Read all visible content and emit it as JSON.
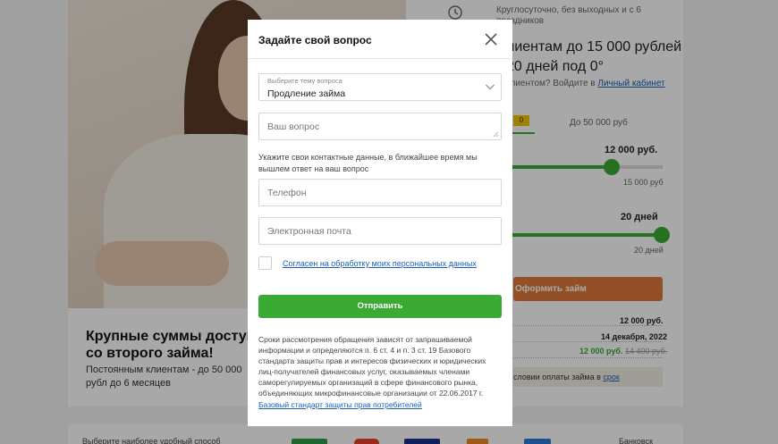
{
  "background": {
    "clock_text": "Круглосуточно, без выходных и с 6 праздников",
    "headline_line1": "лиентам до 15 000 рублей",
    "headline_line2": "20 дней под 0°",
    "client_prompt": "клиентом? Войдите в",
    "cabinet_link": "Личный кабинет",
    "tab_badge": "0",
    "tab_other": "До 50 000 руб",
    "amount_value": "12 000 руб.",
    "amount_max": "15 000 руб",
    "days_value": "20 дней",
    "days_max": "20 дней",
    "apply_button": "Оформить займ",
    "summary_amount": "12 000 руб.",
    "summary_date": "14 декабря, 2022",
    "summary_new": "12 000 руб.",
    "summary_old": "14 400 руб.",
    "grace_text": "словии оплаты займа в",
    "grace_link": "срок",
    "promo_title": "Крупные суммы доступн со второго займа!",
    "promo_text": "Постоянным клиентам - до 50 000 рубл до 6 месяцев",
    "payment_label": "Выберите наиболее удобный способ",
    "payment_right": "Банковск"
  },
  "modal": {
    "title": "Задайте свой вопрос",
    "topic_label": "Выберите тему вопроса",
    "topic_value": "Продление займа",
    "question_placeholder": "Ваш вопрос",
    "contact_hint": "Укажите свои контактные данные, в ближайшее время мы вышлем ответ на ваш вопрос",
    "phone_placeholder": "Телефон",
    "email_placeholder": "Электронная почта",
    "consent_label": "Согласен на обработку моих персональных данных",
    "submit_label": "Отправить",
    "terms_text": "Сроки рассмотрения обращения зависят от запрашиваемой информации и определяются п. 6 ст. 4 и п. 3 ст. 19 Базового стандарта защиты прав и интересов физических и юридических лиц-получателей финансовых услуг, оказываемых членами саморегулируемых организаций в сфере финансового рынка, объединяющих микрофинансовые организации от 22.06.2017 г.",
    "terms_link": "Базовый стандарт защиты прав потребителей"
  },
  "colors": {
    "accent_green": "#3aaa35",
    "accent_orange": "#e07a3a",
    "link_blue": "#1a5fb4"
  }
}
